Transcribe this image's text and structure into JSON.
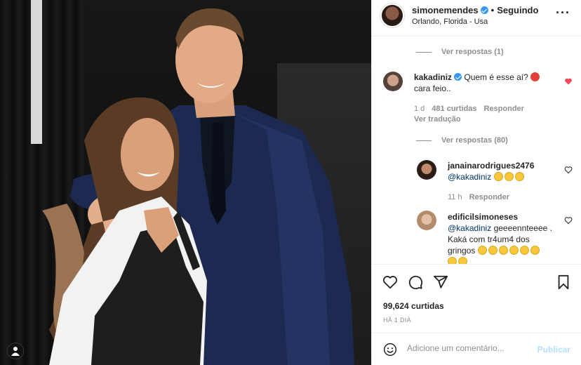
{
  "header": {
    "username": "simonemendes",
    "follow_status": "Seguindo",
    "location": "Orlando, Florida - Usa"
  },
  "comments": {
    "view_replies_top": "Ver respostas (1)",
    "main": {
      "username": "kakadiniz",
      "text": "Quem é esse aí?",
      "text_line2": "cara feio..",
      "time": "1 d",
      "likes": "481 curtidas",
      "reply": "Responder",
      "translate": "Ver tradução"
    },
    "view_replies_main": "Ver respostas (80)",
    "reply1": {
      "username": "janainarodrigues2476",
      "mention": "@kakadiniz",
      "time": "11 h",
      "reply": "Responder"
    },
    "reply2": {
      "username": "edificilsimoneses",
      "mention": "@kakadiniz",
      "text": "geeeennteeee .",
      "text_line2": "Kaká com tr4um4 dos",
      "text_line3": "gringos"
    }
  },
  "post": {
    "likes": "99,624 curtidas",
    "age": "HÁ 1 DIA"
  },
  "composer": {
    "placeholder": "Adicione um comentário...",
    "publish": "Publicar"
  },
  "icons": {
    "verified": "verified-badge-icon",
    "heart": "heart-icon",
    "comment": "comment-icon",
    "share": "share-icon",
    "save": "bookmark-icon",
    "emoji": "emoji-icon",
    "more": "more-options-icon",
    "user": "user-tag-icon"
  },
  "colors": {
    "verified": "#3897f0",
    "liked_heart": "#ed4956",
    "link": "#00376b",
    "publish_disabled": "#b2dffc"
  }
}
